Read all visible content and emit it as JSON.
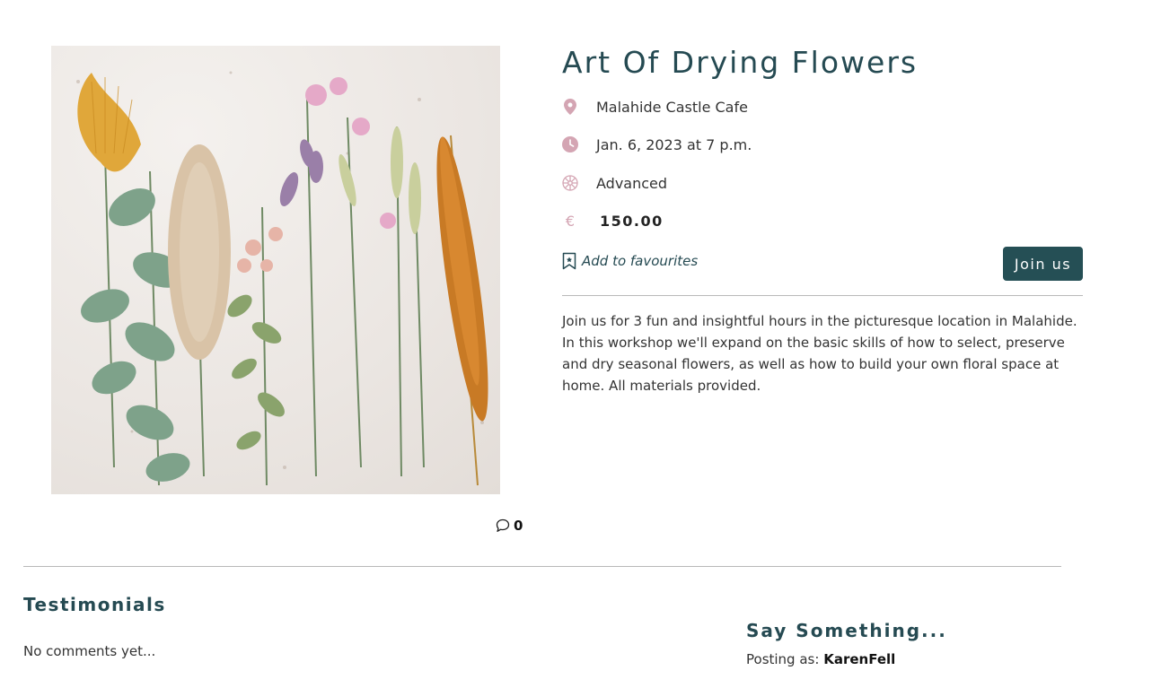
{
  "event": {
    "title": "Art Of Drying Flowers",
    "location": "Malahide Castle Cafe",
    "date": "Jan. 6, 2023 at 7 p.m.",
    "level": "Advanced",
    "currency_symbol": "€",
    "price": "150.00",
    "favourite_label": "Add to favourites",
    "join_label": "Join us",
    "description": "Join us for 3 fun and insightful hours in the picturesque location in Malahide. In this workshop we'll expand on the basic skills of how to select, preserve and dry seasonal flowers, as well as how to build your own floral space at home. All materials provided.",
    "comment_count": "0"
  },
  "icons": {
    "location": "map-pin-icon",
    "date": "clock-icon",
    "level": "flower-icon",
    "price": "euro-icon",
    "favourite": "bookmark-icon",
    "comments": "comment-bubble-icon"
  },
  "testimonials": {
    "title": "Testimonials",
    "empty_text": "No comments yet..."
  },
  "comment_form": {
    "title": "Say Something...",
    "posting_label": "Posting as:",
    "username": "KarenFell"
  },
  "colors": {
    "brand": "#254f55",
    "icon_accent": "#d4a5b3",
    "divider": "#b9b9b9"
  }
}
